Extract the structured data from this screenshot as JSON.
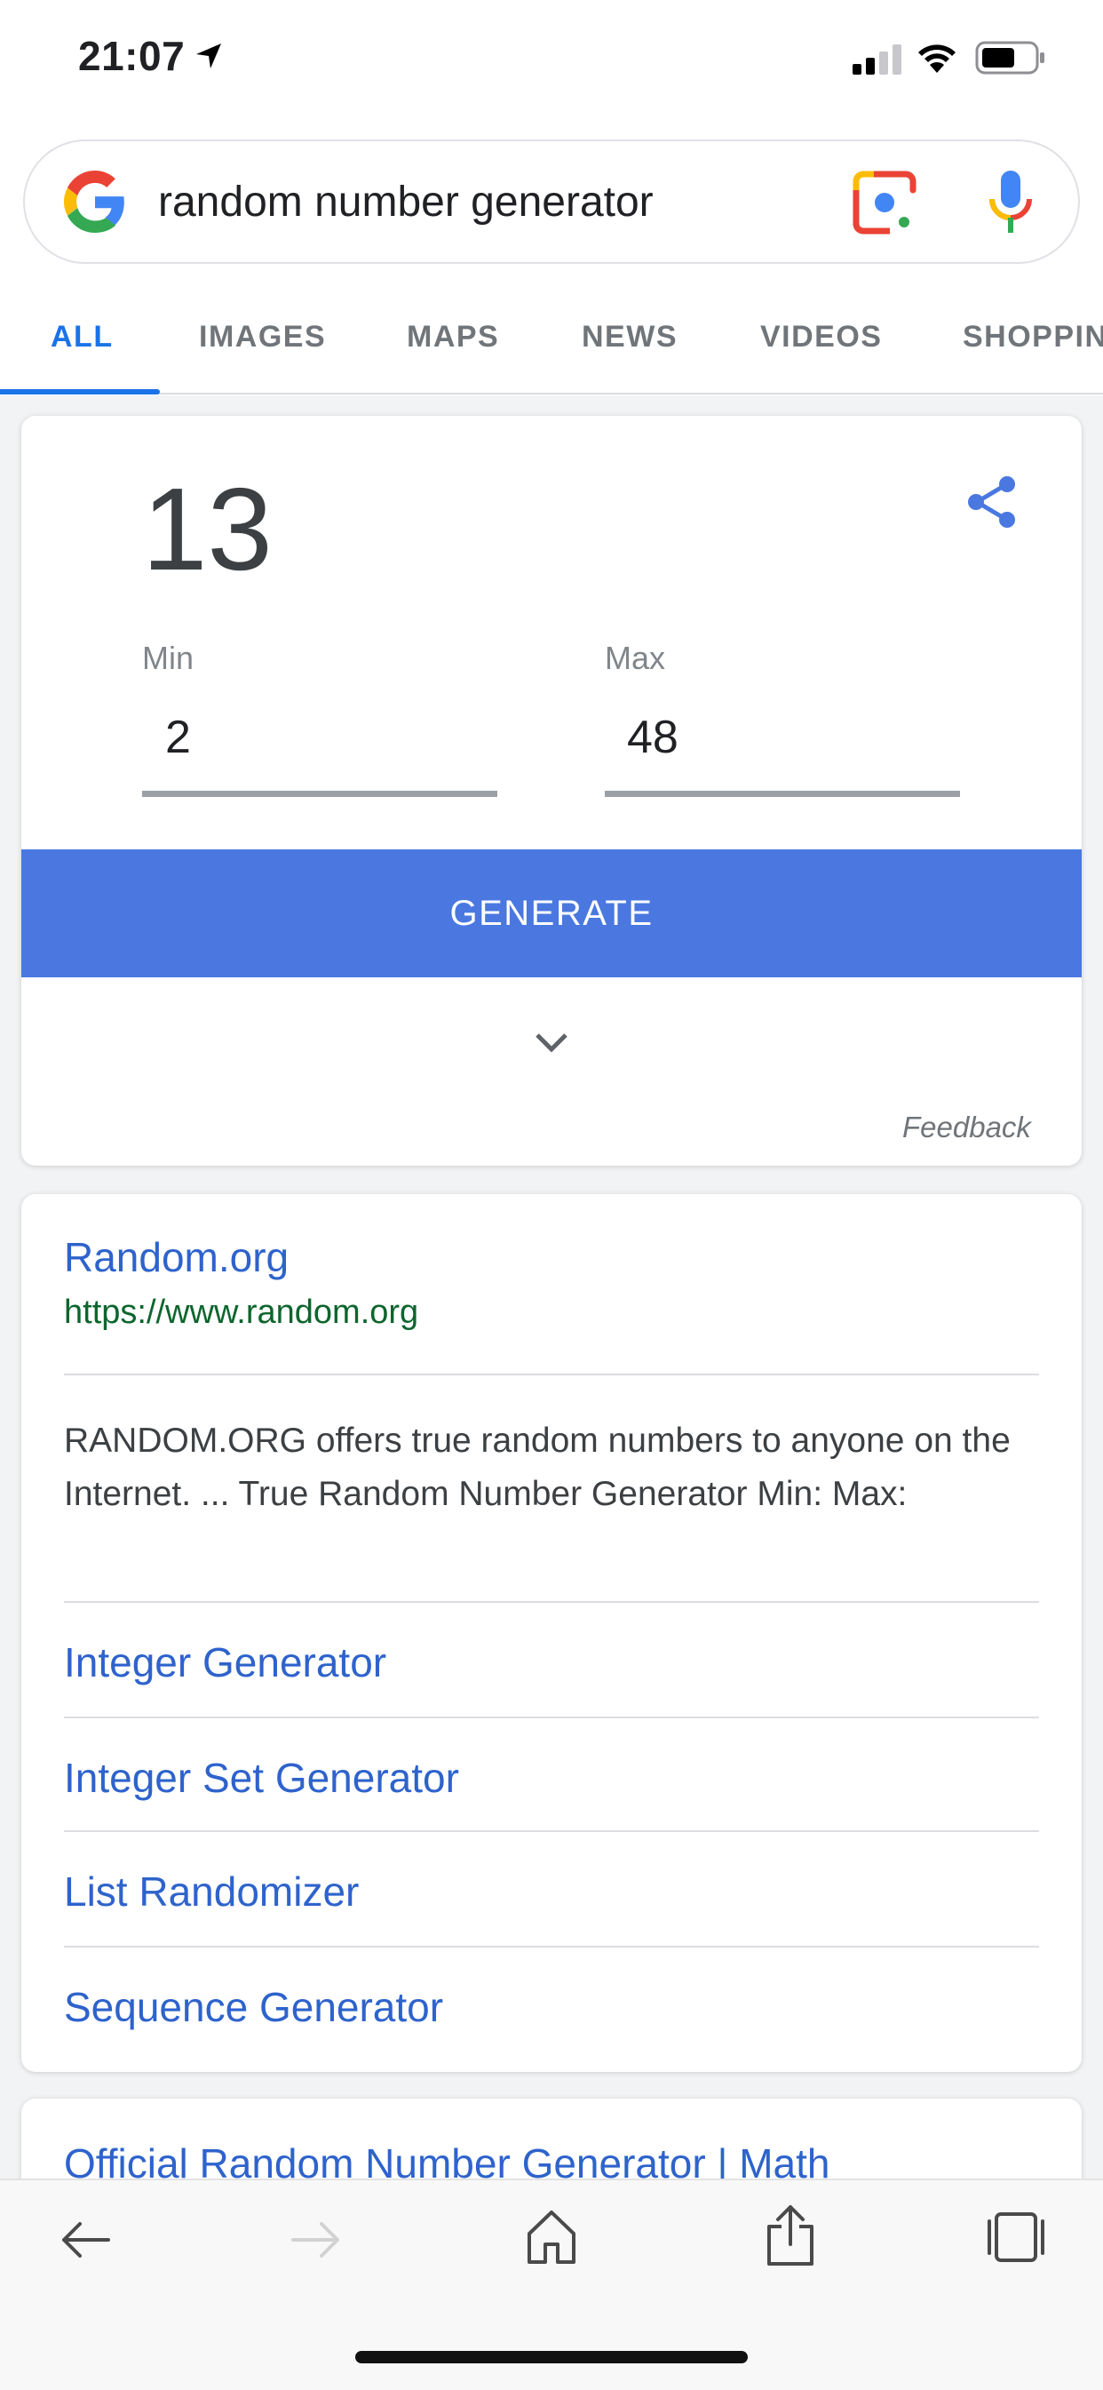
{
  "status_bar": {
    "time": "21:07",
    "icons": [
      "location-arrow-icon",
      "cellular-signal-icon",
      "wifi-icon",
      "battery-icon"
    ]
  },
  "search": {
    "query": "random number generator",
    "icons": [
      "google-logo-icon",
      "google-lens-icon",
      "microphone-icon"
    ]
  },
  "tabs": [
    {
      "label": "ALL",
      "active": true
    },
    {
      "label": "IMAGES",
      "active": false
    },
    {
      "label": "MAPS",
      "active": false
    },
    {
      "label": "NEWS",
      "active": false
    },
    {
      "label": "VIDEOS",
      "active": false
    },
    {
      "label": "SHOPPIN",
      "active": false
    }
  ],
  "rng_widget": {
    "result": "13",
    "min_label": "Min",
    "min_value": "2",
    "max_label": "Max",
    "max_value": "48",
    "generate_label": "GENERATE",
    "feedback_label": "Feedback",
    "accent_color": "#4a78e0"
  },
  "result": {
    "title": "Random.org",
    "url": "https://www.random.org",
    "snippet": "RANDOM.ORG offers true random numbers to anyone on the Internet. ... True Random Number Generator Min: Max:",
    "sitelinks": [
      "Integer Generator",
      "Integer Set Generator",
      "List Randomizer",
      "Sequence Generator"
    ]
  },
  "next_result": {
    "title": "Official Random Number Generator | Math"
  },
  "toolbar": {
    "icons": [
      "back-arrow-icon",
      "forward-arrow-icon",
      "home-icon",
      "share-icon",
      "tabs-icon"
    ]
  }
}
